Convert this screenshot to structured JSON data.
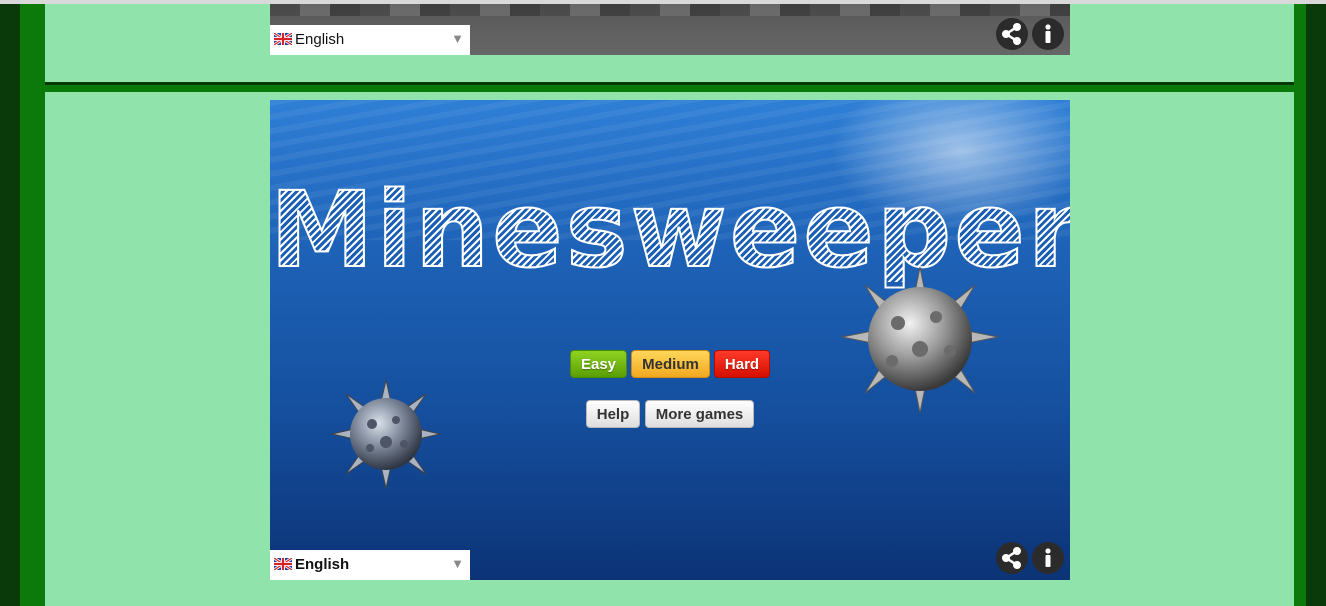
{
  "game": {
    "title": "Minesweeper",
    "difficulty": {
      "easy_label": "Easy",
      "medium_label": "Medium",
      "hard_label": "Hard"
    },
    "help_label": "Help",
    "more_games_label": "More games"
  },
  "language_selector_top": {
    "selected": "English",
    "flag_icon": "uk-flag-icon"
  },
  "language_selector_bottom": {
    "selected": "English",
    "flag_icon": "uk-flag-icon"
  },
  "icons": {
    "share": "share-icon",
    "info": "info-icon",
    "mine": "sea-mine-icon"
  },
  "colors": {
    "page_background": "#8fe3ab",
    "side_green": "#0b7a0b",
    "side_dark": "#0a3a0a",
    "easy": "#6cb80f",
    "medium": "#f5b52a",
    "hard": "#e81a0c"
  }
}
